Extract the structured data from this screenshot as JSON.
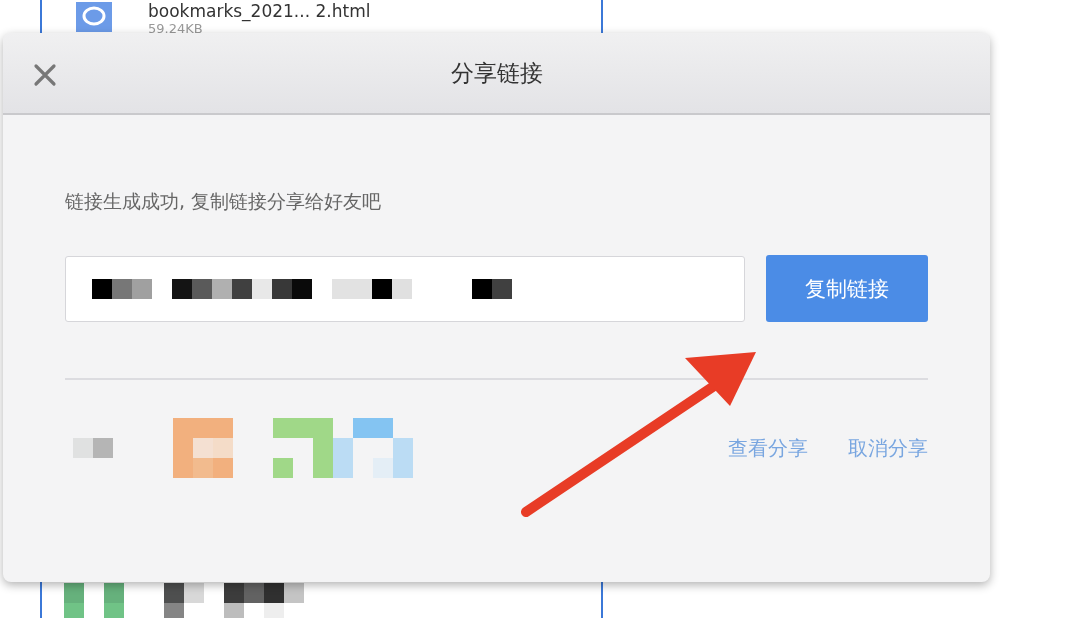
{
  "background_file": {
    "name": "bookmarks_2021...  2.html",
    "size": "59.24KB"
  },
  "dialog": {
    "title": "分享链接",
    "message": "链接生成成功, 复制链接分享给好友吧",
    "copy_button": "复制链接",
    "links": [
      "查看分享",
      "取消分享"
    ]
  }
}
